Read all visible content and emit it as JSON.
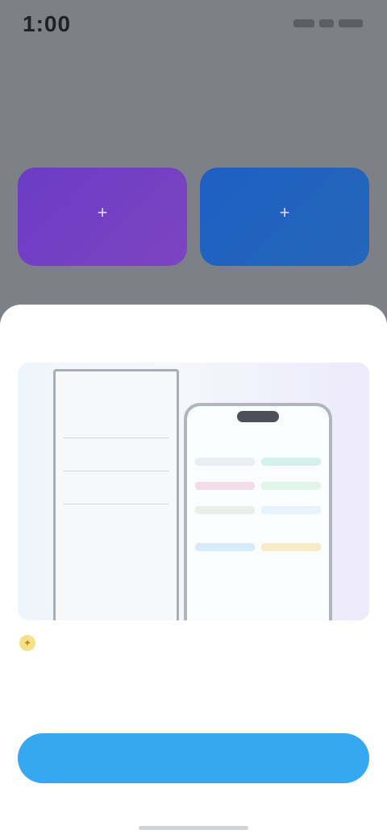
{
  "status_bar": {
    "time": "1:00",
    "icons": [
      "signal-icon",
      "wifi-icon",
      "battery-icon"
    ]
  },
  "background_screen": {
    "heading": "",
    "tiles": [
      {
        "label": "",
        "icon": "plus-icon",
        "color": "#6b3cc6"
      },
      {
        "label": "",
        "icon": "plus-icon",
        "color": "#1f5fc4"
      }
    ]
  },
  "sheet": {
    "title": "",
    "illustration": {
      "doc_header": "",
      "doc_label": "",
      "phone_app_title": ""
    },
    "tip": {
      "icon": "lightbulb-icon",
      "title": "",
      "description": ""
    },
    "cta_label": ""
  },
  "colors": {
    "accent": "#35a8f1",
    "tip_icon": "#f6e08a",
    "tile_purple": "#6b3cc6",
    "tile_blue": "#1f5fc4"
  }
}
